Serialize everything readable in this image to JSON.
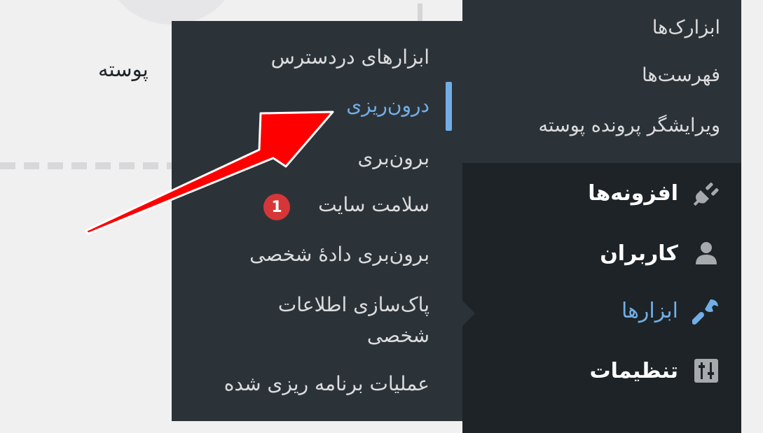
{
  "background": {
    "label": "پوسته"
  },
  "sidebar": {
    "submenu_items": [
      "ابزارک‌ها",
      "فهرست‌ها",
      "ویرایشگر پرونده پوسته"
    ],
    "menu_items": [
      {
        "label": "افزونه‌ها",
        "icon": "plugin-icon"
      },
      {
        "label": "کاربران",
        "icon": "user-icon"
      },
      {
        "label": "ابزارها",
        "icon": "wrench-icon",
        "active": true
      },
      {
        "label": "تنظیمات",
        "icon": "settings-sliders-icon"
      }
    ]
  },
  "flyout": {
    "items": [
      {
        "label": "ابزارهای دردسترس"
      },
      {
        "label": "درون‌ریزی",
        "active": true
      },
      {
        "label": "برون‌بری"
      },
      {
        "label": "سلامت سایت",
        "badge": "1"
      },
      {
        "label": "برون‌بری دادهٔ شخصی"
      },
      {
        "label": "پاک‌سازی اطلاعات شخصی"
      },
      {
        "label": "عملیات برنامه ریزی شده"
      }
    ]
  },
  "colors": {
    "sidebar_bg": "#1d2327",
    "submenu_bg": "#2c3338",
    "active_blue": "#72aee6",
    "badge_red": "#d63638",
    "annotation_arrow_red": "#ff0000"
  }
}
